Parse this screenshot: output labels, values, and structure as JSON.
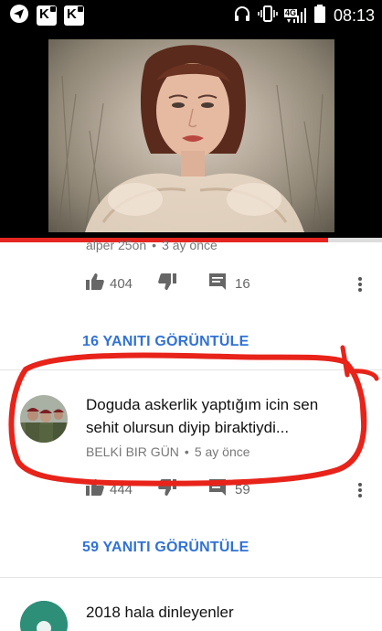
{
  "status_bar": {
    "time": "08:13",
    "network": "4G",
    "icons": [
      "send-icon",
      "k-app-icon",
      "k-app-icon",
      "headphones-icon",
      "vibrate-icon",
      "signal-icon",
      "battery-icon"
    ]
  },
  "video": {
    "progress_fraction": 0.86,
    "accent_color": "#e52521"
  },
  "comments": [
    {
      "author": "alper 25on",
      "time": "3 ay önce",
      "likes": "404",
      "replies_count": "16",
      "view_replies_label": "16 YANITI GÖRÜNTÜLE"
    },
    {
      "text_line1": "Doguda askerlik yaptığım icin sen",
      "text_line2": "sehit olursun diyip biraktiydi...",
      "author": "BELKİ BIR GÜN",
      "time": "5 ay önce",
      "likes": "444",
      "replies_count": "59",
      "view_replies_label": "59 YANITI GÖRÜNTÜLE"
    },
    {
      "text": "2018 hala dinleyenler"
    }
  ],
  "meta_separator": "•",
  "colors": {
    "link": "#3172d6",
    "annotation": "#e8231a"
  }
}
